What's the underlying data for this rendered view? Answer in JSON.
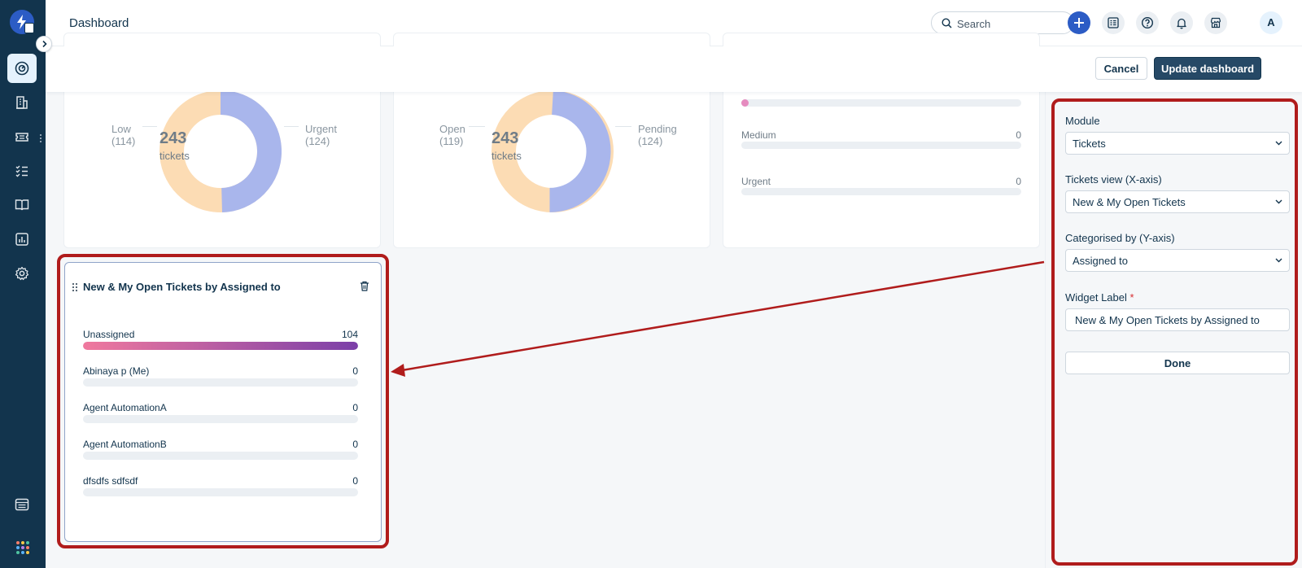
{
  "header": {
    "title": "Dashboard",
    "search_placeholder": "Search",
    "avatar_initial": "A"
  },
  "actions": {
    "cancel_label": "Cancel",
    "update_label": "Update dashboard"
  },
  "widgets": {
    "priority_donut": {
      "total": "243",
      "unit": "tickets",
      "left_label": "Low",
      "left_count": "(114)",
      "right_label": "Urgent",
      "right_count": "(124)"
    },
    "status_donut": {
      "total": "243",
      "unit": "tickets",
      "left_label": "Open",
      "left_count": "(119)",
      "right_label": "Pending",
      "right_count": "(124)"
    },
    "priority_list": {
      "rows": [
        {
          "label": "Medium",
          "value": "0"
        },
        {
          "label": "Urgent",
          "value": "0"
        }
      ]
    },
    "assigned": {
      "title": "New & My Open Tickets by Assigned to",
      "max": 104,
      "rows": [
        {
          "label": "Unassigned",
          "value": "104",
          "num": 104
        },
        {
          "label": "Abinaya p (Me)",
          "value": "0",
          "num": 0
        },
        {
          "label": "Agent AutomationA",
          "value": "0",
          "num": 0
        },
        {
          "label": "Agent AutomationB",
          "value": "0",
          "num": 0
        },
        {
          "label": "dfsdfs sdfsdf",
          "value": "0",
          "num": 0
        }
      ]
    }
  },
  "panel": {
    "module_label": "Module",
    "module_value": "Tickets",
    "view_label": "Tickets view (X-axis)",
    "view_value": "New & My Open Tickets",
    "category_label": "Categorised by (Y-axis)",
    "category_value": "Assigned to",
    "widget_label_label": "Widget Label",
    "required_mark": "*",
    "widget_label_value": "New & My Open Tickets by Assigned to",
    "done_label": "Done"
  },
  "colors": {
    "sidebar": "#12344d",
    "primary": "#2c5cc5",
    "annotation": "#b01c1c",
    "donut_left": "#fcdcb4",
    "donut_right": "#a9b6ec"
  }
}
